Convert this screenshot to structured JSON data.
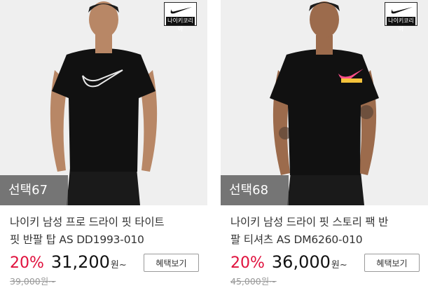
{
  "products": [
    {
      "select_label": "선택67",
      "brand_label": "나이키코리아",
      "title_line1": "나이키 남성 프로 드라이 핏 타이트",
      "title_line2": "핏 반팔 탑 AS DD1993-010",
      "discount": "20%",
      "price": "31,200",
      "price_unit": "원~",
      "original_price": "39,000원~",
      "benefit_button": "혜택보기"
    },
    {
      "select_label": "선택68",
      "brand_label": "나이키코리아",
      "title_line1": "나이키 남성 드라이 핏 스토리 팩 반",
      "title_line2": "팔 티셔츠 AS DM6260-010",
      "discount": "20%",
      "price": "36,000",
      "price_unit": "원~",
      "original_price": "45,000원~",
      "benefit_button": "혜택보기"
    }
  ],
  "colors": {
    "discount": "#e0113d",
    "select_overlay": "#5a5a5a"
  }
}
